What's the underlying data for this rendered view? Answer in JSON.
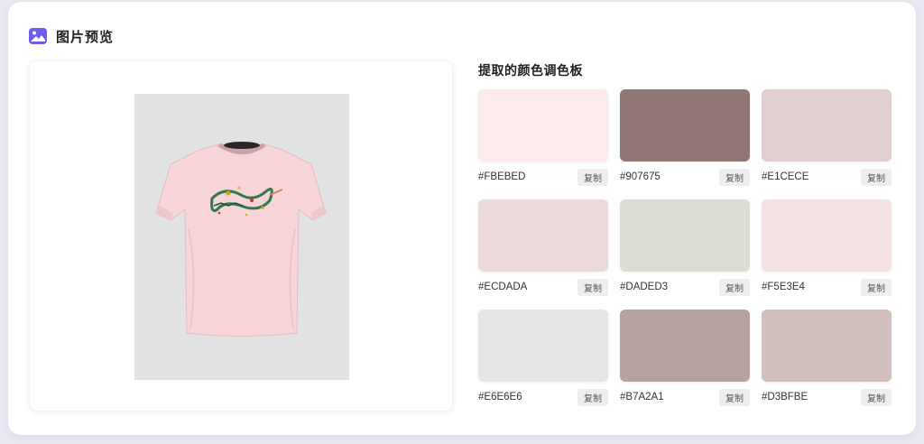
{
  "header": {
    "title": "图片预览",
    "icon": "image-icon",
    "icon_color": "#6c5ce7"
  },
  "preview": {
    "image": "pink-tshirt-image",
    "shirt_color": "#f6d4d8",
    "background_color": "#e2e2e2"
  },
  "palette": {
    "title": "提取的颜色调色板",
    "copy_label": "复制",
    "colors": [
      {
        "hex": "#FBEBED",
        "copy_label": "复制"
      },
      {
        "hex": "#907675",
        "copy_label": "复制"
      },
      {
        "hex": "#E1CECE",
        "copy_label": "复制"
      },
      {
        "hex": "#ECDADA",
        "copy_label": "复制"
      },
      {
        "hex": "#DADED3",
        "copy_label": "复制"
      },
      {
        "hex": "#F5E3E4",
        "copy_label": "复制"
      },
      {
        "hex": "#E6E6E6",
        "copy_label": "复制"
      },
      {
        "hex": "#B7A2A1",
        "copy_label": "复制"
      },
      {
        "hex": "#D3BFBE",
        "copy_label": "复制"
      }
    ]
  }
}
